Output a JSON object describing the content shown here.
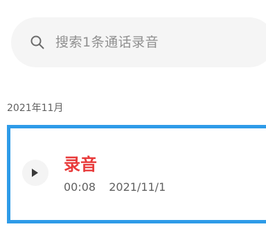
{
  "search": {
    "placeholder": "搜索1条通话录音",
    "icon": "search-icon"
  },
  "group": {
    "label": "2021年11月"
  },
  "record": {
    "title": "录音",
    "duration": "00:08",
    "date": "2021/11/1",
    "play_icon": "play-icon"
  },
  "colors": {
    "title_red": "#e83a3a",
    "selection_blue": "#2e9be8",
    "search_bg": "#f5f5f5"
  }
}
